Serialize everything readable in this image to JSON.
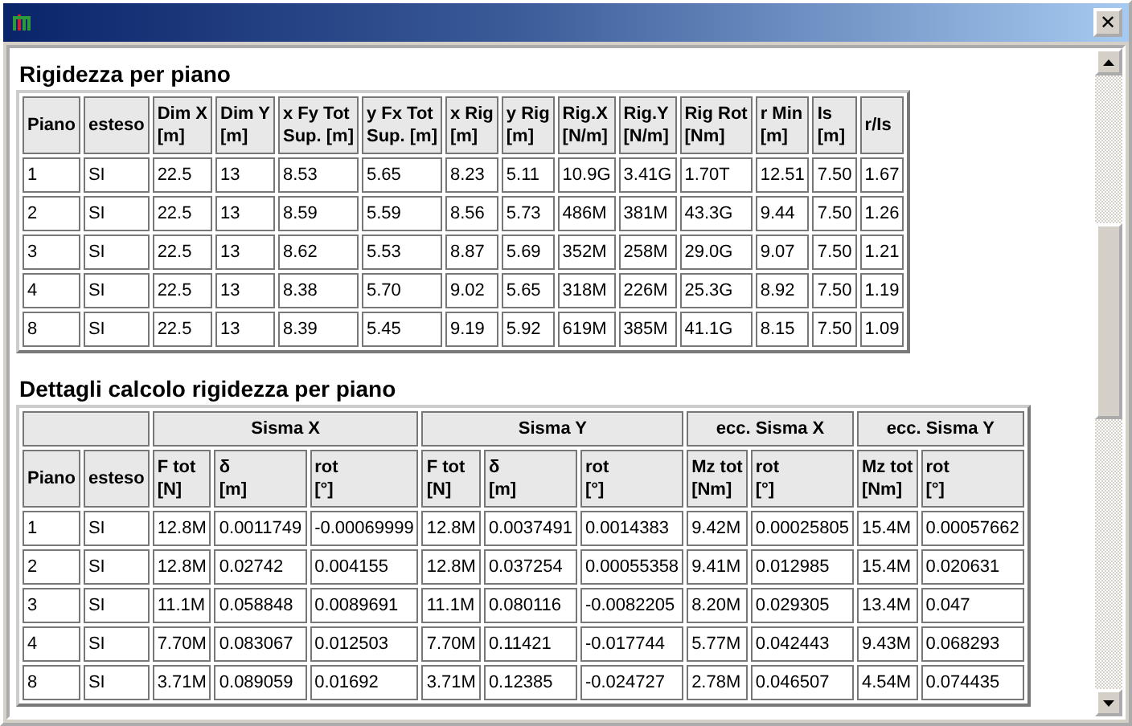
{
  "window": {
    "close": "✕"
  },
  "sections": [
    {
      "heading": "Rigidezza per piano",
      "columns": [
        {
          "name": "Piano"
        },
        {
          "name": "esteso"
        },
        {
          "name": "Dim X",
          "unit": "[m]"
        },
        {
          "name": "Dim Y",
          "unit": "[m]"
        },
        {
          "name": "x Fy Tot",
          "unit": "Sup. [m]"
        },
        {
          "name": "y Fx Tot",
          "unit": "Sup. [m]"
        },
        {
          "name": "x Rig",
          "unit": "[m]"
        },
        {
          "name": "y Rig",
          "unit": "[m]"
        },
        {
          "name": "Rig.X",
          "unit": "[N/m]"
        },
        {
          "name": "Rig.Y",
          "unit": "[N/m]"
        },
        {
          "name": "Rig Rot",
          "unit": "[Nm]"
        },
        {
          "name": "r Min",
          "unit": "[m]"
        },
        {
          "name": "Is",
          "unit": "[m]"
        },
        {
          "name": "r/Is"
        }
      ],
      "rows": [
        [
          "1",
          "SI",
          "22.5",
          "13",
          "8.53",
          "5.65",
          "8.23",
          "5.11",
          "10.9G",
          "3.41G",
          "1.70T",
          "12.51",
          "7.50",
          "1.67"
        ],
        [
          "2",
          "SI",
          "22.5",
          "13",
          "8.59",
          "5.59",
          "8.56",
          "5.73",
          "486M",
          "381M",
          "43.3G",
          "9.44",
          "7.50",
          "1.26"
        ],
        [
          "3",
          "SI",
          "22.5",
          "13",
          "8.62",
          "5.53",
          "8.87",
          "5.69",
          "352M",
          "258M",
          "29.0G",
          "9.07",
          "7.50",
          "1.21"
        ],
        [
          "4",
          "SI",
          "22.5",
          "13",
          "8.38",
          "5.70",
          "9.02",
          "5.65",
          "318M",
          "226M",
          "25.3G",
          "8.92",
          "7.50",
          "1.19"
        ],
        [
          "8",
          "SI",
          "22.5",
          "13",
          "8.39",
          "5.45",
          "9.19",
          "5.92",
          "619M",
          "385M",
          "41.1G",
          "8.15",
          "7.50",
          "1.09"
        ]
      ]
    },
    {
      "heading": "Dettagli calcolo rigidezza per piano",
      "columns": [
        {
          "name": "Piano"
        },
        {
          "name": "esteso"
        }
      ],
      "groups": [
        {
          "label": "Sisma X",
          "columns": [
            {
              "name": "F tot",
              "unit": "[N]"
            },
            {
              "name": "δ",
              "unit": "[m]"
            },
            {
              "name": "rot",
              "unit": "[°]"
            }
          ]
        },
        {
          "label": "Sisma Y",
          "columns": [
            {
              "name": "F tot",
              "unit": "[N]"
            },
            {
              "name": "δ",
              "unit": "[m]"
            },
            {
              "name": "rot",
              "unit": "[°]"
            }
          ]
        },
        {
          "label": "ecc. Sisma X",
          "columns": [
            {
              "name": "Mz tot",
              "unit": "[Nm]"
            },
            {
              "name": "rot",
              "unit": "[°]"
            }
          ]
        },
        {
          "label": "ecc. Sisma Y",
          "columns": [
            {
              "name": "Mz tot",
              "unit": "[Nm]"
            },
            {
              "name": "rot",
              "unit": "[°]"
            }
          ]
        }
      ],
      "rows": [
        [
          "1",
          "SI",
          "12.8M",
          "0.0011749",
          "-0.00069999",
          "12.8M",
          "0.0037491",
          "0.0014383",
          "9.42M",
          "0.00025805",
          "15.4M",
          "0.00057662"
        ],
        [
          "2",
          "SI",
          "12.8M",
          "0.02742",
          "0.004155",
          "12.8M",
          "0.037254",
          "0.00055358",
          "9.41M",
          "0.012985",
          "15.4M",
          "0.020631"
        ],
        [
          "3",
          "SI",
          "11.1M",
          "0.058848",
          "0.0089691",
          "11.1M",
          "0.080116",
          "-0.0082205",
          "8.20M",
          "0.029305",
          "13.4M",
          "0.047"
        ],
        [
          "4",
          "SI",
          "7.70M",
          "0.083067",
          "0.012503",
          "7.70M",
          "0.11421",
          "-0.017744",
          "5.77M",
          "0.042443",
          "9.43M",
          "0.068293"
        ],
        [
          "8",
          "SI",
          "3.71M",
          "0.089059",
          "0.01692",
          "3.71M",
          "0.12385",
          "-0.024727",
          "2.78M",
          "0.046507",
          "4.54M",
          "0.074435"
        ]
      ]
    }
  ]
}
